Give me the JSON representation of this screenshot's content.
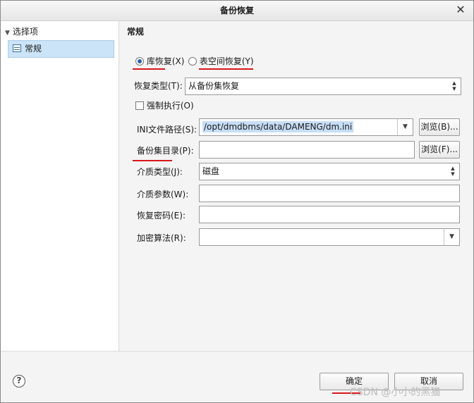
{
  "window": {
    "title": "备份恢复",
    "close_glyph": "✕"
  },
  "sidebar": {
    "header": "选择项",
    "items": [
      {
        "label": "常规",
        "icon": "document-icon"
      }
    ]
  },
  "main": {
    "section_title": "常规",
    "restore_mode": {
      "db": {
        "label": "库恢复(X)",
        "selected": true
      },
      "tablespace": {
        "label": "表空间恢复(Y)",
        "selected": false
      }
    },
    "restore_type": {
      "label": "恢复类型(T):",
      "value": "从备份集恢复"
    },
    "force": {
      "label": "强制执行(O)",
      "checked": false
    },
    "ini_path": {
      "label": "INI文件路径(S):",
      "value": "/opt/dmdbms/data/DAMENG/dm.ini",
      "browse": "浏览(B)..."
    },
    "backup_dir": {
      "label": "备份集目录(P):",
      "value": "",
      "browse": "浏览(F)..."
    },
    "media_type": {
      "label": "介质类型(J):",
      "value": "磁盘"
    },
    "media_param": {
      "label": "介质参数(W):",
      "value": ""
    },
    "restore_pwd": {
      "label": "恢复密码(E):",
      "value": ""
    },
    "encrypt_alg": {
      "label": "加密算法(R):",
      "value": ""
    }
  },
  "footer": {
    "help": "?",
    "ok": "确定",
    "cancel": "取消",
    "watermark": "CSDN @小小的黑猫"
  },
  "colors": {
    "annotation_red": "#d9161b",
    "selection_blue": "#cce4f7"
  }
}
